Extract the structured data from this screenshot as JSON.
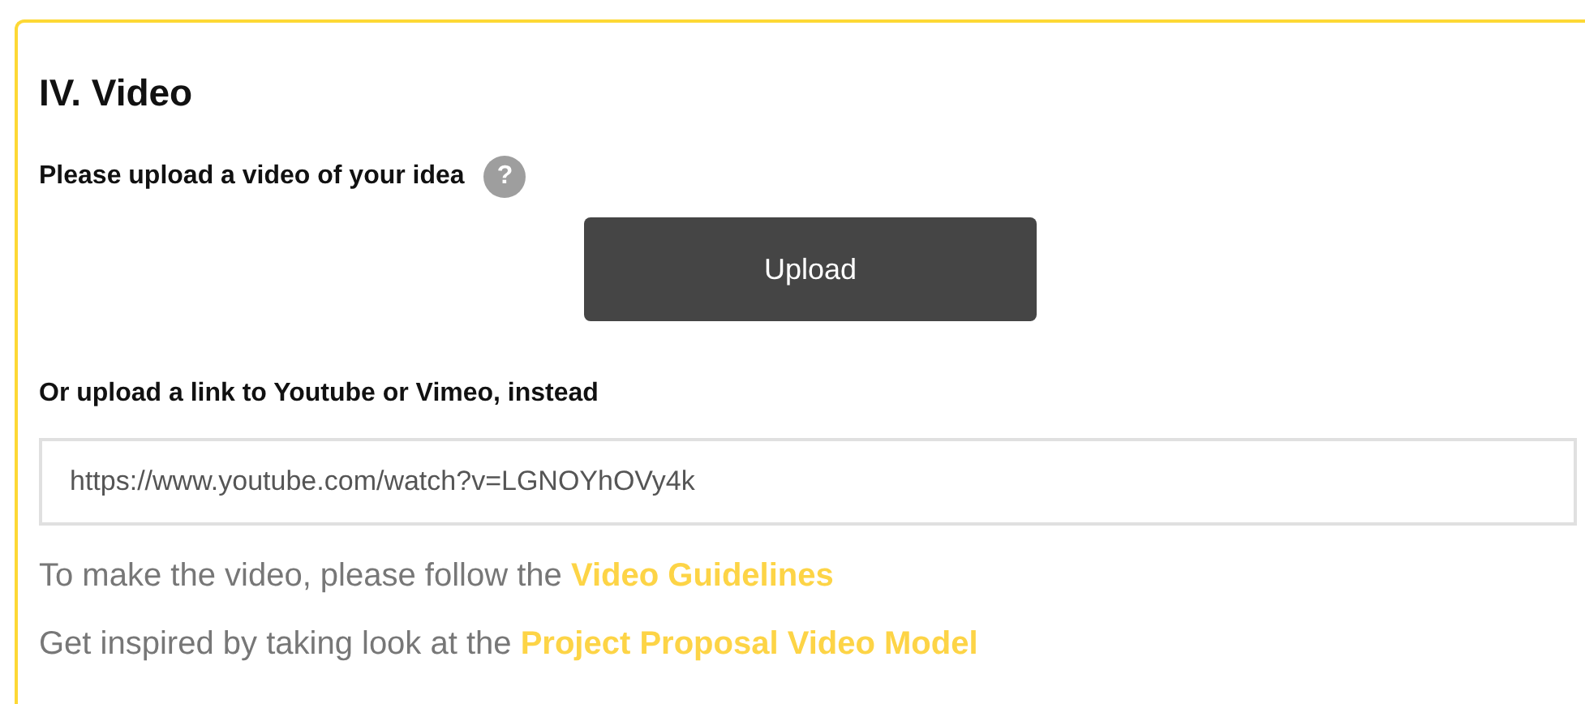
{
  "section": {
    "title": "IV. Video",
    "upload_label": "Please upload a video of your idea",
    "help_icon": "?",
    "upload_button": "Upload",
    "link_label": "Or upload a link to Youtube or Vimeo, instead",
    "link_field": {
      "value": "https://www.youtube.com/watch?v=LGNOYhOVy4k"
    },
    "notes": [
      {
        "text": "To make the video, please follow the",
        "link": "Video Guidelines"
      },
      {
        "text": "Get inspired by taking look at the",
        "link": "Project Proposal Video Model"
      }
    ]
  }
}
